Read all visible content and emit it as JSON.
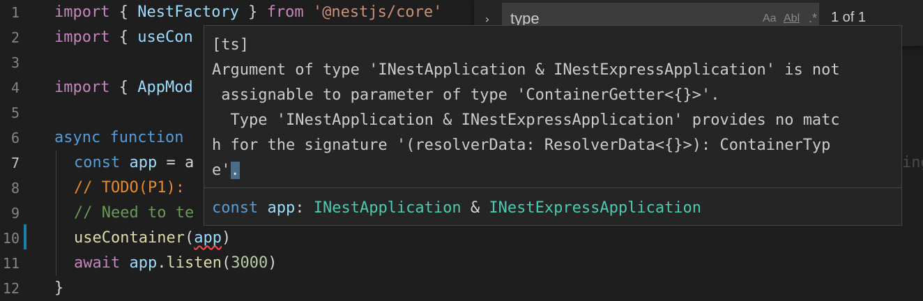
{
  "editor": {
    "line_numbers": [
      "1",
      "2",
      "3",
      "4",
      "5",
      "6",
      "7",
      "8",
      "9",
      "10",
      "11",
      "12"
    ],
    "line1": {
      "import_kw": "import",
      "open": " { ",
      "name": "NestFactory",
      "close": " } ",
      "from_kw": "from",
      "space": " ",
      "module": "'@nestjs/core'"
    },
    "line2": {
      "import_kw": "import",
      "open": " { ",
      "name": "useCon"
    },
    "line4": {
      "import_kw": "import",
      "open": " { ",
      "name": "AppMod"
    },
    "line6": {
      "async_kw": "async",
      "function_kw": "function"
    },
    "line7": {
      "const_kw": "const",
      "var": "app",
      "rest": " = a"
    },
    "line8": {
      "comment": "// TODO(P1): "
    },
    "line9": {
      "comment": "// Need to te"
    },
    "line10": {
      "fn": "useContainer",
      "open": "(",
      "arg": "app",
      "close": ")"
    },
    "line11": {
      "await_kw": "await",
      "obj": "app",
      "dot": ".",
      "method": "listen",
      "open": "(",
      "num": "3000",
      "close": ")"
    },
    "line12": {
      "brace": "}"
    },
    "faded_tail": "ing"
  },
  "find_widget": {
    "chevron": "›",
    "value": "type",
    "match_case": "Aa",
    "whole_word": "Abl",
    "regex": ".*",
    "count": "1 of 1"
  },
  "hover": {
    "source": "[ts]",
    "message_lines": [
      "Argument of type 'INestApplication & INestExpressApplication' is not",
      " assignable to parameter of type 'ContainerGetter<{}>'.",
      "  Type 'INestApplication & INestExpressApplication' provides no matc",
      "h for the signature '(resolverData: ResolverData<{}>): ContainerTyp"
    ],
    "last_line_prefix": "e'",
    "last_line_selected": ".",
    "signature": {
      "const_kw": "const",
      "var": "app",
      "colon": ": ",
      "type1": "INestApplication",
      "amp": " & ",
      "type2": "INestExpressApplication"
    }
  }
}
